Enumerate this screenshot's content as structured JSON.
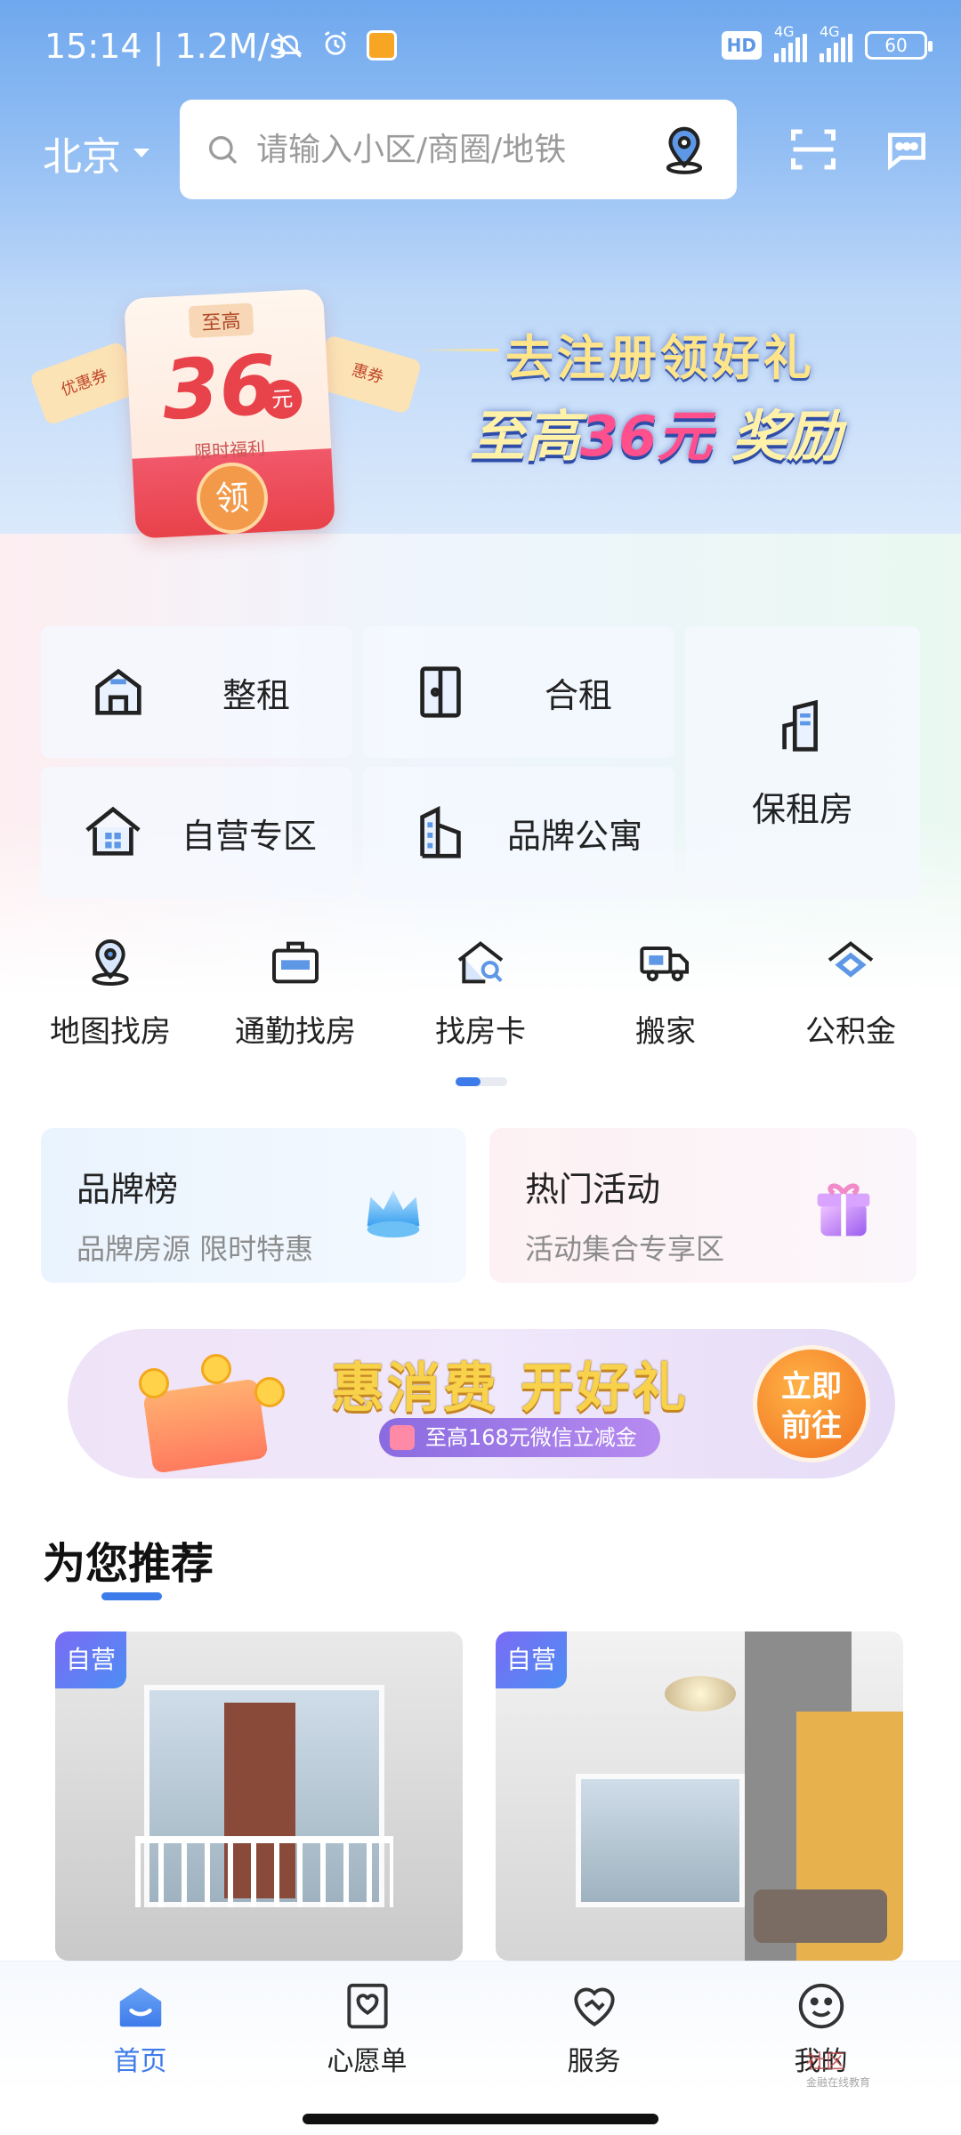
{
  "status_bar": {
    "time": "15:14",
    "speed": "| 1.2M/s",
    "network_label": "4G",
    "network_label_2": "4G",
    "hd": "HD",
    "battery": "60"
  },
  "header": {
    "city": "北京",
    "search_placeholder": "请输入小区/商圈/地铁",
    "icons": [
      "search-icon",
      "location-icon",
      "scan-icon",
      "message-icon"
    ]
  },
  "banner": {
    "title": "去注册领好礼",
    "subtitle_prefix": "至高",
    "subtitle_amount": "36元",
    "subtitle_suffix": "奖励",
    "coupon_top": "至高",
    "coupon_amount": "36",
    "coupon_unit": "元",
    "coupon_note": "限时福利",
    "coupon_claim": "领",
    "ticket_left": "优惠券",
    "ticket_right": "惠券"
  },
  "categories": [
    {
      "label": "整租",
      "icon": "house-icon"
    },
    {
      "label": "合租",
      "icon": "door-icon"
    },
    {
      "label": "自营专区",
      "icon": "home-building-icon"
    },
    {
      "label": "品牌公寓",
      "icon": "apartment-icon"
    },
    {
      "label": "保租房",
      "icon": "tower-icon"
    }
  ],
  "quick_links": [
    {
      "label": "地图找房",
      "icon": "map-pin-icon"
    },
    {
      "label": "通勤找房",
      "icon": "briefcase-icon"
    },
    {
      "label": "找房卡",
      "icon": "house-search-icon"
    },
    {
      "label": "搬家",
      "icon": "truck-icon"
    },
    {
      "label": "公积金",
      "icon": "fund-icon"
    }
  ],
  "promos": [
    {
      "title": "品牌榜",
      "subtitle": "品牌房源 限时特惠",
      "icon": "crown-icon"
    },
    {
      "title": "热门活动",
      "subtitle": "活动集合专享区",
      "icon": "gift-box-icon"
    }
  ],
  "ad": {
    "title": "惠消费 开好礼",
    "pill": "至高168元微信立减金",
    "cta": "立即前往"
  },
  "recommend": {
    "title": "为您推荐",
    "cards": [
      {
        "tag": "自营"
      },
      {
        "tag": "自营"
      }
    ]
  },
  "bottom_nav": [
    {
      "label": "首页",
      "icon": "home-icon",
      "active": true
    },
    {
      "label": "心愿单",
      "icon": "wishlist-icon",
      "active": false
    },
    {
      "label": "服务",
      "icon": "service-heart-icon",
      "active": false
    },
    {
      "label": "我的",
      "icon": "smile-icon",
      "active": false
    }
  ],
  "watermark": {
    "text": "社区",
    "sub": "金融在线教育"
  },
  "colors": {
    "accent": "#3d7bea",
    "header_bg": "#6fa8ee",
    "coupon_red": "#e8424a"
  }
}
